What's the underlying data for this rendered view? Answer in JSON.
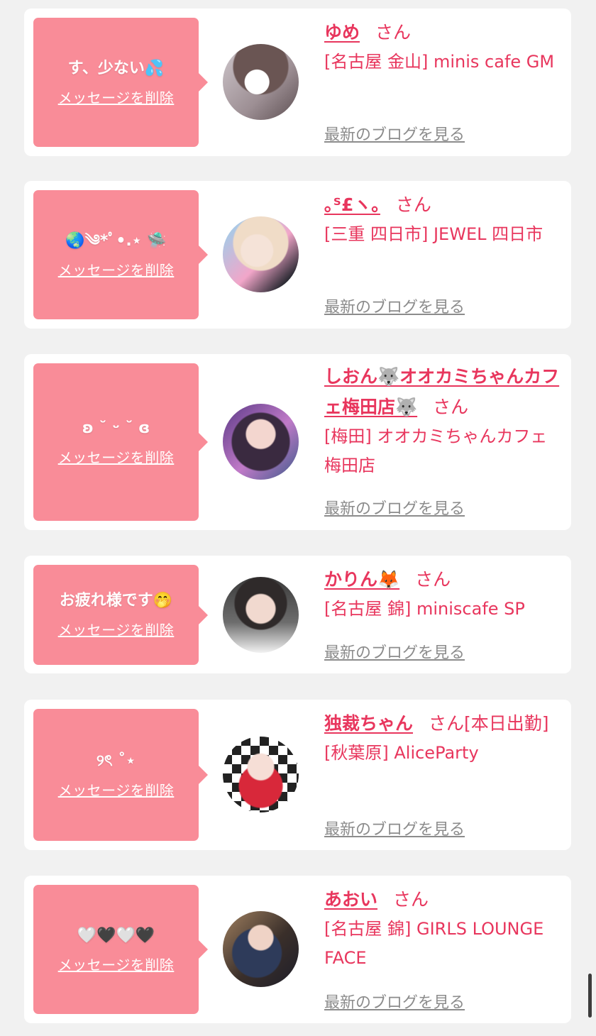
{
  "delete_label": "メッセージを削除",
  "blog_label": "最新のブログを見る",
  "san_label": "さん",
  "colors": {
    "accent": "#e8365d",
    "bubble": "#f98c98",
    "link_gray": "#8c8c8c"
  },
  "cards": [
    {
      "message": "す、少ない💦",
      "name": "ゆめ",
      "shop": "[名古屋 金山] minis cafe GM"
    },
    {
      "message": "🌏༄*ﾟ•.⋆ 🛸",
      "name": "｡ᔆ£ヽ｡",
      "shop": "[三重 四日市] JEWEL 四日市"
    },
    {
      "message": "ʚ ˘ ᵕ ˘ ɞ",
      "name": "しおん🐺オオカミちゃんカフェ梅田店🐺",
      "shop": "[梅田] オオカミちゃんカフェ梅田店"
    },
    {
      "message": "お疲れ様です🤭",
      "name": "かりん🦊",
      "shop": "[名古屋 錦] miniscafe SP"
    },
    {
      "message": "୨ৎ ˚⋆",
      "name": "独裁ちゃん",
      "extra": "[本日出勤]",
      "shop": "[秋葉原] AliceParty"
    },
    {
      "message": "🤍🖤🤍🖤",
      "name": "あおい",
      "shop": "[名古屋 錦] GIRLS LOUNGE FACE"
    }
  ]
}
